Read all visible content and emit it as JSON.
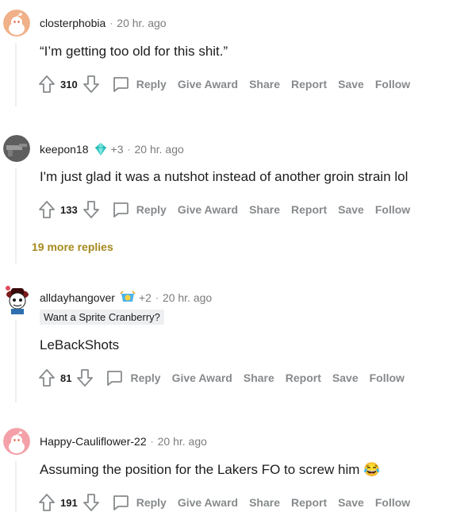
{
  "comments": [
    {
      "author": "closterphobia",
      "time": "20 hr. ago",
      "body": "“I’m getting too old for this shit.”",
      "score": "310",
      "avatar_color": "#f0b088"
    },
    {
      "author": "keepon18",
      "award_count": "+3",
      "time": "20 hr. ago",
      "body": "I'm just glad it was a nutshot instead of another groin strain lol",
      "score": "133",
      "more_replies": "19 more replies",
      "avatar_color": "#6b6b6b"
    },
    {
      "author": "alldayhangover",
      "award_count": "+2",
      "time": "20 hr. ago",
      "flair": "Want a Sprite Cranberry?",
      "body": "LeBackShots",
      "score": "81",
      "avatar_color": "#2a2a2a"
    },
    {
      "author": "Happy-Cauliflower-22",
      "time": "20 hr. ago",
      "body": "Assuming the position for the Lakers FO to screw him 😂",
      "score": "191",
      "avatar_color": "#f4a0a8"
    }
  ],
  "actions": {
    "reply": "Reply",
    "give_award": "Give Award",
    "share": "Share",
    "report": "Report",
    "save": "Save",
    "follow": "Follow"
  },
  "separator": "·",
  "colors": {
    "gold_link": "#a5891d",
    "muted": "#878a8c",
    "text": "#1c1c1c"
  },
  "icons": [
    "upvote-icon",
    "downvote-icon",
    "reply-icon",
    "award-icon",
    "avatar-icon"
  ]
}
